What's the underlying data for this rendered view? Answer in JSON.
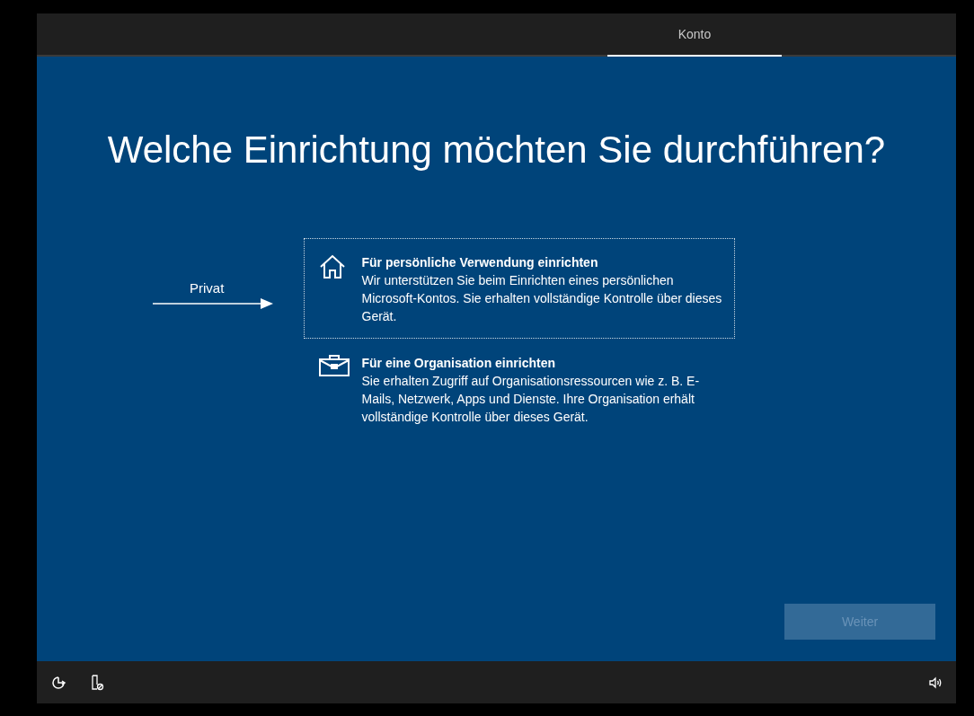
{
  "tabs": [
    {
      "label": "Konto",
      "selected": true
    }
  ],
  "heading": "Welche Einrichtung möchten Sie durchführen?",
  "annotation": {
    "label": "Privat"
  },
  "options": [
    {
      "kind": "home",
      "title": "Für persönliche Verwendung einrichten",
      "description": "Wir unterstützen Sie beim Einrichten eines persönlichen Microsoft-Kontos. Sie erhalten vollständige Kontrolle über dieses Gerät.",
      "selected": true
    },
    {
      "kind": "briefcase",
      "title": "Für eine Organisation einrichten",
      "description": "Sie erhalten Zugriff auf Organisationsressourcen wie z. B. E-Mails, Netzwerk, Apps und Dienste. Ihre Organisation erhält vollständige Kontrolle über dieses Gerät.",
      "selected": false
    }
  ],
  "next_button": {
    "label": "Weiter",
    "disabled": true
  }
}
